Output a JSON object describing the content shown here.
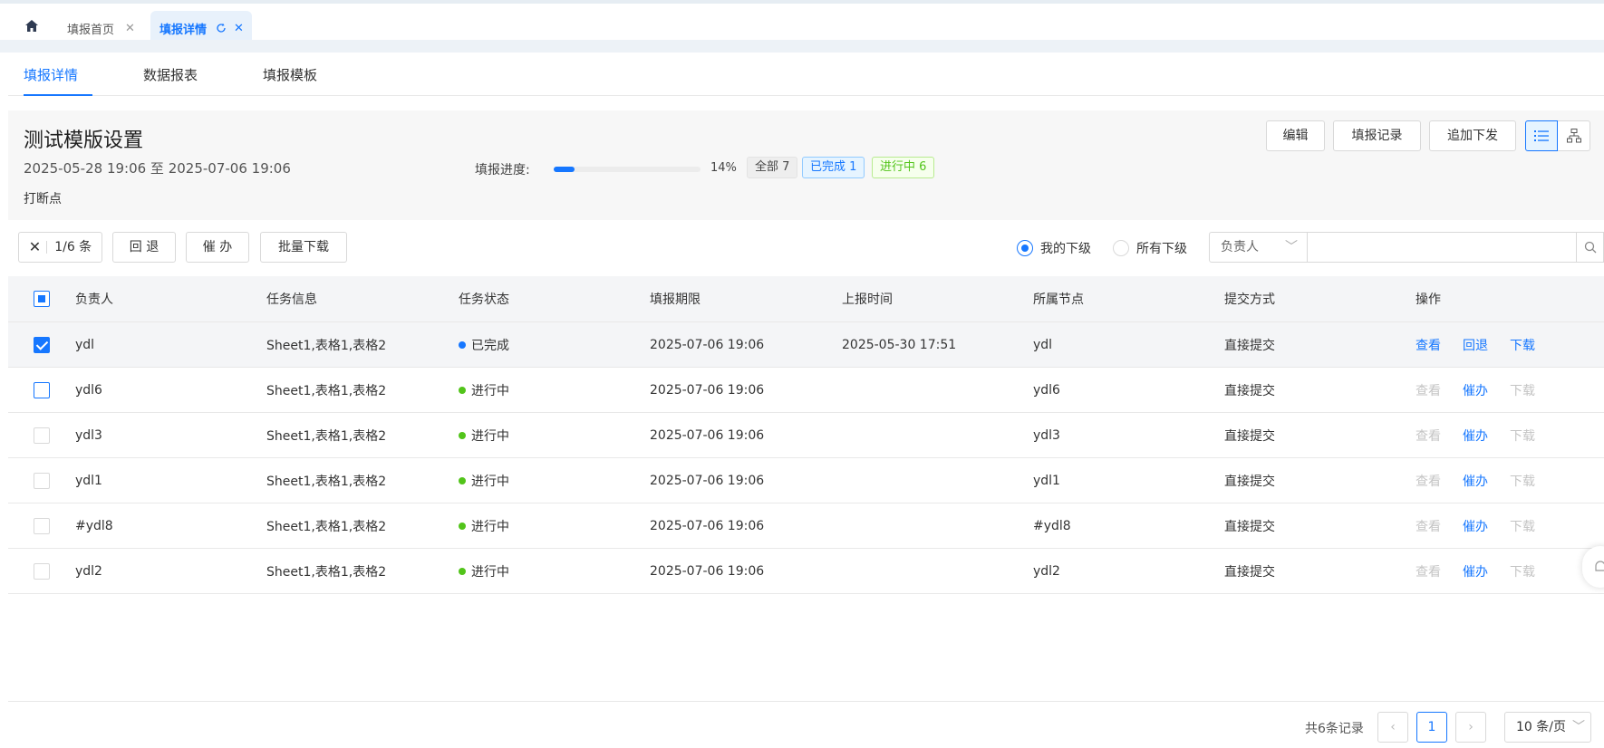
{
  "tabs": [
    {
      "label": "填报首页"
    },
    {
      "label": "填报详情"
    }
  ],
  "subtabs": [
    "填报详情",
    "数据报表",
    "填报模板"
  ],
  "header": {
    "title": "测试模版设置",
    "date_range": "2025-05-28 19:06 至 2025-07-06 19:06",
    "note": "打断点",
    "progress_label": "填报进度:",
    "progress_percent": "14%",
    "progress_value": 0.14,
    "tag_all": "全部 7",
    "tag_done": "已完成 1",
    "tag_doing": "进行中 6",
    "btn_edit": "编辑",
    "btn_record": "填报记录",
    "btn_append": "追加下发"
  },
  "toolbar": {
    "selected_count": "1/6 条",
    "btn_back": "回 退",
    "btn_urge": "催 办",
    "btn_batch": "批量下载",
    "radio_mine": "我的下级",
    "radio_all": "所有下级",
    "owner_select": "负责人",
    "search_value": ""
  },
  "table": {
    "headers": [
      "负责人",
      "任务信息",
      "任务状态",
      "填报期限",
      "上报时间",
      "所属节点",
      "提交方式",
      "操作"
    ],
    "rows": [
      {
        "owner": "ydl",
        "info": "Sheet1,表格1,表格2",
        "status": "已完成",
        "deadline": "2025-07-06 19:06",
        "report": "2025-05-30 17:51",
        "node": "ydl",
        "submit": "直接提交",
        "ops": [
          "查看",
          "回退",
          "下载"
        ]
      },
      {
        "owner": "ydl6",
        "info": "Sheet1,表格1,表格2",
        "status": "进行中",
        "deadline": "2025-07-06 19:06",
        "report": "",
        "node": "ydl6",
        "submit": "直接提交",
        "ops": [
          "查看",
          "催办",
          "下载"
        ]
      },
      {
        "owner": "ydl3",
        "info": "Sheet1,表格1,表格2",
        "status": "进行中",
        "deadline": "2025-07-06 19:06",
        "report": "",
        "node": "ydl3",
        "submit": "直接提交",
        "ops": [
          "查看",
          "催办",
          "下载"
        ]
      },
      {
        "owner": "ydl1",
        "info": "Sheet1,表格1,表格2",
        "status": "进行中",
        "deadline": "2025-07-06 19:06",
        "report": "",
        "node": "ydl1",
        "submit": "直接提交",
        "ops": [
          "查看",
          "催办",
          "下载"
        ]
      },
      {
        "owner": "#ydl8",
        "info": "Sheet1,表格1,表格2",
        "status": "进行中",
        "deadline": "2025-07-06 19:06",
        "report": "",
        "node": "#ydl8",
        "submit": "直接提交",
        "ops": [
          "查看",
          "催办",
          "下载"
        ]
      },
      {
        "owner": "ydl2",
        "info": "Sheet1,表格1,表格2",
        "status": "进行中",
        "deadline": "2025-07-06 19:06",
        "report": "",
        "node": "ydl2",
        "submit": "直接提交",
        "ops": [
          "查看",
          "催办",
          "下载"
        ]
      }
    ]
  },
  "pager": {
    "total": "共6条记录",
    "current": "1",
    "page_size": "10 条/页"
  },
  "colors": {
    "accent": "#1677ff",
    "done_dot": "#1677ff",
    "doing_dot": "#52c41a"
  }
}
